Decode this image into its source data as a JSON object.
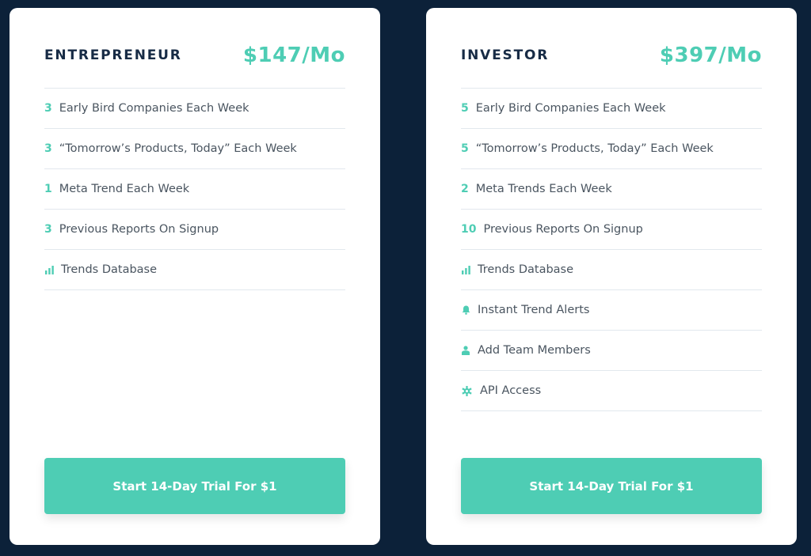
{
  "colors": {
    "accent": "#4ecdb4",
    "background": "#0c2139",
    "heading": "#172b45",
    "text": "#4a5560"
  },
  "plans": [
    {
      "name": "ENTREPRENEUR",
      "price": "$147/Mo",
      "features": [
        {
          "num": "3",
          "label": "Early Bird Companies Each Week"
        },
        {
          "num": "3",
          "label": "“Tomorrow’s Products, Today” Each Week"
        },
        {
          "num": "1",
          "label": "Meta Trend Each Week"
        },
        {
          "num": "3",
          "label": "Previous Reports On Signup"
        },
        {
          "icon": "bar-chart-icon",
          "label": "Trends Database"
        }
      ],
      "cta_label": "Start 14-Day Trial For $1"
    },
    {
      "name": "INVESTOR",
      "price": "$397/Mo",
      "features": [
        {
          "num": "5",
          "label": "Early Bird Companies Each Week"
        },
        {
          "num": "5",
          "label": "“Tomorrow’s Products, Today” Each Week"
        },
        {
          "num": "2",
          "label": "Meta Trends Each Week"
        },
        {
          "num": "10",
          "label": "Previous Reports On Signup"
        },
        {
          "icon": "bar-chart-icon",
          "label": "Trends Database"
        },
        {
          "icon": "bell-icon",
          "label": "Instant Trend Alerts"
        },
        {
          "icon": "user-icon",
          "label": "Add Team Members"
        },
        {
          "icon": "gear-icon",
          "label": "API Access"
        }
      ],
      "cta_label": "Start 14-Day Trial For $1"
    }
  ]
}
